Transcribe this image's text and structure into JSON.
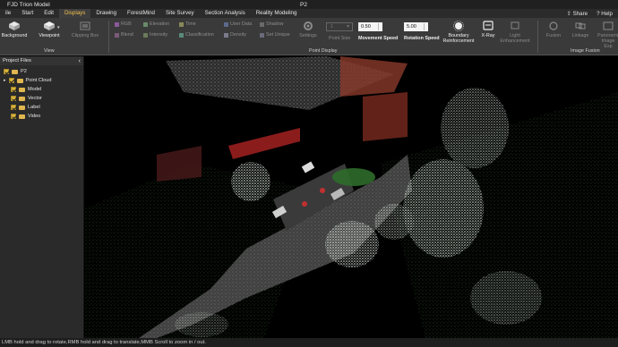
{
  "titlebar": {
    "app_title": "FJD Trion Model",
    "doc_title": "P2"
  },
  "menu": {
    "items": [
      "ile",
      "Start",
      "Edit",
      "Displays",
      "Drawing",
      "ForestMind",
      "Site Survey",
      "Section Analysis",
      "Reality Modeling"
    ],
    "active": "Displays",
    "share": "Share",
    "help": "Help"
  },
  "ribbon": {
    "view": {
      "background": "Background",
      "viewpoint": "Viewpoint",
      "clipping_box": "Clipping Box",
      "group_label": "View"
    },
    "color_modes": {
      "rgb": "RGB",
      "elevation": "Elevation",
      "time": "Time",
      "user_data": "User Data",
      "shadow": "Shadow",
      "blend": "Blend",
      "intensity": "Intensity",
      "classification": "Classification",
      "density": "Density",
      "set_unique": "Set Unique"
    },
    "settings": "Settings",
    "point_size": {
      "label": "Point Size",
      "value": "1"
    },
    "movement_speed": {
      "label": "Movement Speed",
      "value": "0.50"
    },
    "rotation_speed": {
      "label": "Rotation Speed",
      "value": "5.00"
    },
    "boundary": "Boundary Reinforcement",
    "xray": "X-Ray",
    "light_enhancement": "Light Enhancement",
    "point_display_label": "Point Display",
    "fusion": "Fusion",
    "linkage": "Linkage",
    "panorama": "Panoramic Image Exp",
    "image_fusion_label": "Image Fusion"
  },
  "panel": {
    "title": "Project Files",
    "root": "P2",
    "items": [
      "Point Cloud",
      "Model",
      "Vector",
      "Label",
      "Video"
    ]
  },
  "status": "LMB hold and drag to rotate,RMB hold and drag to translate,MMB Scroll to zoom in / out.",
  "colors": {
    "accent": "#f2c14e",
    "checkbox": "#d8b23a",
    "panel_bg": "#2a2a2a",
    "ribbon_bg": "#3a3a3a"
  }
}
